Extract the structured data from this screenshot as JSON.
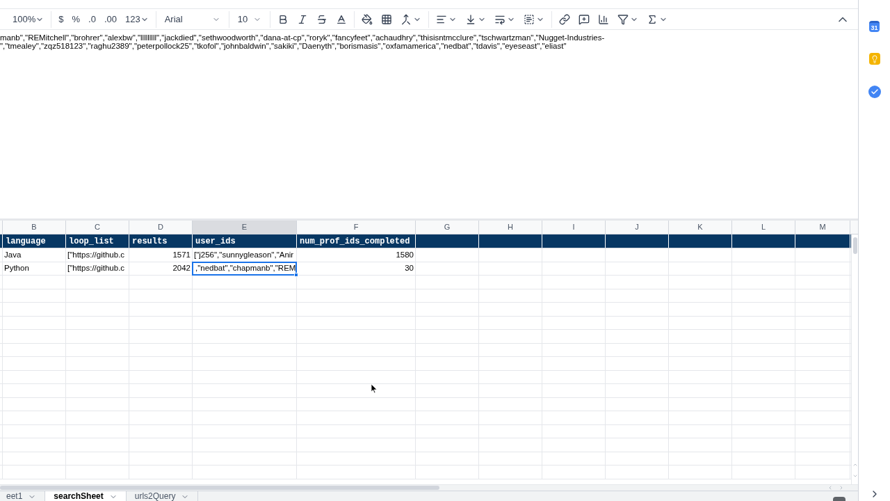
{
  "toolbar": {
    "zoom": "100%",
    "currency": "$",
    "percent": "%",
    "decrease_decimals": ".0",
    "increase_decimals": ".00",
    "number_format": "123",
    "font": "Arial",
    "font_size": "10"
  },
  "formula_bar": {
    "lines": [
      "manb\",\"REMitchell\",\"brohrer\",\"alexbw\",\"lllllllll\",\"jackdied\",\"sethwoodworth\",\"dana-at-cp\",\"roryk\",\"fancyfeet\",\"achaudhry\",\"thisisntmcclure\",\"tschwartzman\",\"Nugget-Industries-",
      "\",\"tmealey\",\"zqz518123\",\"raghu2389\",\"peterpollock25\",\"tkofol\",\"johnbaldwin\",\"sakiki\",\"Daenyth\",\"borismasis\",\"oxfamamerica\",\"nedbat\",\"tdavis\",\"eyeseast\",\"eliast\""
    ]
  },
  "sheet": {
    "columns": [
      {
        "letter": "B",
        "selected": false
      },
      {
        "letter": "C",
        "selected": false
      },
      {
        "letter": "D",
        "selected": false
      },
      {
        "letter": "E",
        "selected": true
      },
      {
        "letter": "F",
        "selected": false
      },
      {
        "letter": "G",
        "selected": false
      },
      {
        "letter": "H",
        "selected": false
      },
      {
        "letter": "I",
        "selected": false
      },
      {
        "letter": "J",
        "selected": false
      },
      {
        "letter": "K",
        "selected": false
      },
      {
        "letter": "L",
        "selected": false
      },
      {
        "letter": "M",
        "selected": false
      }
    ],
    "header_row": [
      "language",
      "loop_list",
      "results",
      "user_ids",
      "num_prof_ids_completed"
    ],
    "rows": [
      [
        {
          "text": "Java",
          "kind": "text",
          "selected": false
        },
        {
          "text": "[\"https://github.c",
          "kind": "text",
          "selected": false
        },
        {
          "text": "1571",
          "kind": "number",
          "selected": false
        },
        {
          "text": "[\"j256\",\"sunnygleason\",\"Anir",
          "kind": "text",
          "selected": false
        },
        {
          "text": "1580",
          "kind": "number",
          "selected": false
        }
      ],
      [
        {
          "text": "Python",
          "kind": "text",
          "selected": false
        },
        {
          "text": "[\"https://github.c",
          "kind": "text",
          "selected": false
        },
        {
          "text": "2042",
          "kind": "number",
          "selected": false
        },
        {
          "text": ",\"nedbat\",\"chapmanb\",\"REM",
          "kind": "text",
          "selected": true
        },
        {
          "text": "30",
          "kind": "number",
          "selected": false
        }
      ]
    ]
  },
  "sheet_tabs": [
    {
      "label": "eet1",
      "selected": false
    },
    {
      "label": "searchSheet",
      "selected": true
    },
    {
      "label": "urls2Query",
      "selected": false
    }
  ],
  "side_panel": {
    "calendar_day": "31"
  }
}
